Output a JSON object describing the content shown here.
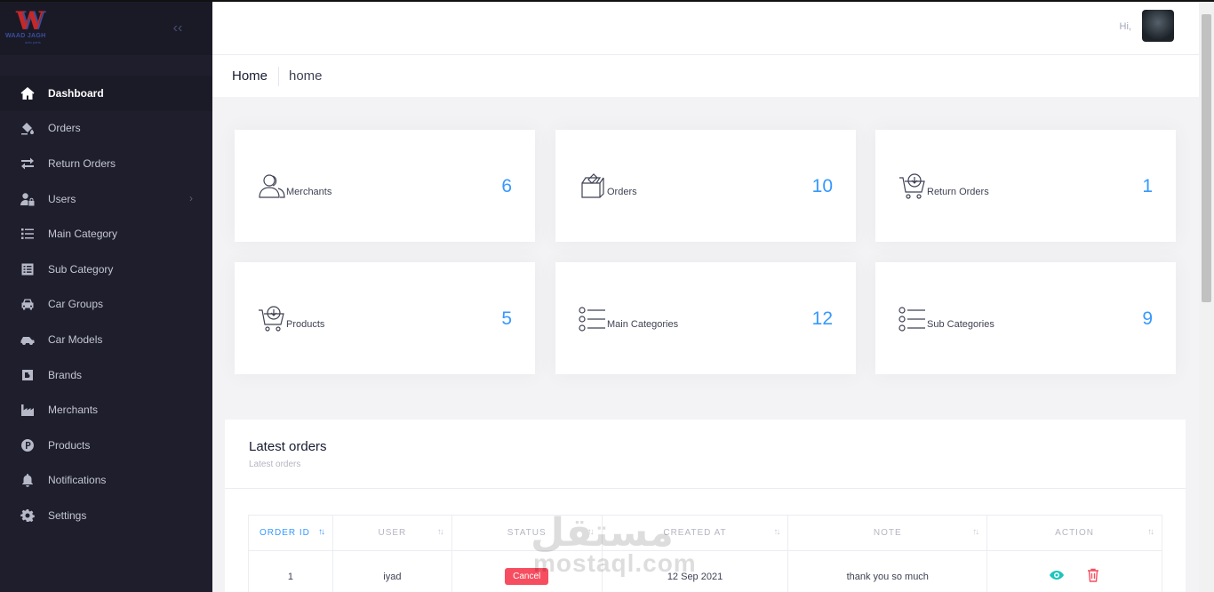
{
  "brand": {
    "logo_letter": "W",
    "logo_text": "WAAD JAGH",
    "logo_sub": "auto parts"
  },
  "sidebar": {
    "items": [
      {
        "label": "Dashboard",
        "icon": "home-icon",
        "active": true
      },
      {
        "label": "Orders",
        "icon": "paint-bucket-icon"
      },
      {
        "label": "Return Orders",
        "icon": "exchange-icon"
      },
      {
        "label": "Users",
        "icon": "user-lock-icon",
        "has_arrow": true
      },
      {
        "label": "Main Category",
        "icon": "list-icon"
      },
      {
        "label": "Sub Category",
        "icon": "list-alt-icon"
      },
      {
        "label": "Car Groups",
        "icon": "car-icon"
      },
      {
        "label": "Car Models",
        "icon": "car-side-icon"
      },
      {
        "label": "Brands",
        "icon": "brand-box-icon"
      },
      {
        "label": "Merchants",
        "icon": "industry-icon"
      },
      {
        "label": "Products",
        "icon": "product-p-icon"
      },
      {
        "label": "Notifications",
        "icon": "bell-icon"
      },
      {
        "label": "Settings",
        "icon": "gear-icon"
      }
    ],
    "collapse_glyph": "‹‹"
  },
  "header": {
    "greeting": "Hi,"
  },
  "breadcrumb": {
    "root": "Home",
    "current": "home"
  },
  "stats": [
    {
      "label": "Merchants",
      "value": "6",
      "icon": "merchants-icon"
    },
    {
      "label": "Orders",
      "value": "10",
      "icon": "box-icon"
    },
    {
      "label": "Return Orders",
      "value": "1",
      "icon": "cart-return-icon"
    },
    {
      "label": "Products",
      "value": "5",
      "icon": "cart-products-icon"
    },
    {
      "label": "Main Categories",
      "value": "12",
      "icon": "category-list-icon"
    },
    {
      "label": "Sub Categories",
      "value": "9",
      "icon": "subcategory-list-icon"
    }
  ],
  "latest_orders": {
    "title": "Latest orders",
    "subtitle": "Latest orders",
    "columns": [
      "ORDER ID",
      "USER",
      "STATUS",
      "CREATED AT",
      "NOTE",
      "ACTION"
    ],
    "rows": [
      {
        "order_id": "1",
        "user": "iyad",
        "status": "Cancel",
        "created_at": "12 Sep 2021",
        "note": "thank you so much"
      }
    ]
  },
  "watermark": {
    "arabic": "مستقل",
    "latin": "mostaql.com"
  },
  "colors": {
    "sidebar_bg": "#1e1e2d",
    "accent": "#3699ff",
    "danger": "#f64e60",
    "view_icon": "#1bc5bd"
  }
}
